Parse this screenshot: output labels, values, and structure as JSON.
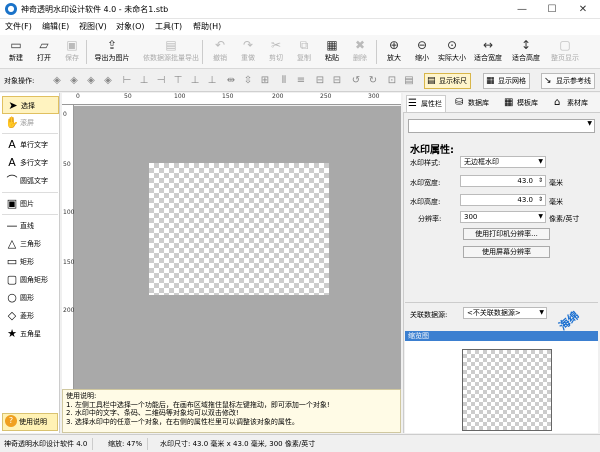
{
  "window": {
    "title": "神奇透明水印设计软件 4.0 - 未命名1.stb",
    "app_icon": "logo-icon",
    "controls": {
      "minimize": "—",
      "maximize": "☐",
      "close": "✕"
    }
  },
  "menu": [
    "文件(F)",
    "编辑(E)",
    "视图(V)",
    "对象(O)",
    "工具(T)",
    "帮助(H)"
  ],
  "toolbar": [
    {
      "label": "新建",
      "icon": "new-icon",
      "glyph": "▭",
      "enabled": true
    },
    {
      "label": "打开",
      "icon": "open-icon",
      "glyph": "▱",
      "enabled": true
    },
    {
      "label": "保存",
      "icon": "save-icon",
      "glyph": "▣",
      "enabled": false
    },
    {
      "label": "导出为图片",
      "icon": "export-image-icon",
      "glyph": "⇪",
      "enabled": true
    },
    {
      "label": "依数据源批量导出",
      "icon": "batch-export-icon",
      "glyph": "▤",
      "enabled": false
    },
    {
      "label": "撤销",
      "icon": "undo-icon",
      "glyph": "↶",
      "enabled": false
    },
    {
      "label": "重做",
      "icon": "redo-icon",
      "glyph": "↷",
      "enabled": false
    },
    {
      "label": "剪切",
      "icon": "cut-icon",
      "glyph": "✂",
      "enabled": false
    },
    {
      "label": "复制",
      "icon": "copy-icon",
      "glyph": "⧉",
      "enabled": false
    },
    {
      "label": "粘贴",
      "icon": "paste-icon",
      "glyph": "▦",
      "enabled": true
    },
    {
      "label": "删除",
      "icon": "delete-icon",
      "glyph": "✖",
      "enabled": false
    },
    {
      "label": "放大",
      "icon": "zoom-in-icon",
      "glyph": "⊕",
      "enabled": true
    },
    {
      "label": "缩小",
      "icon": "zoom-out-icon",
      "glyph": "⊖",
      "enabled": true
    },
    {
      "label": "实际大小",
      "icon": "actual-size-icon",
      "glyph": "⊙",
      "enabled": true
    },
    {
      "label": "适合宽度",
      "icon": "fit-width-icon",
      "glyph": "↔",
      "enabled": true
    },
    {
      "label": "适合高度",
      "icon": "fit-height-icon",
      "glyph": "↕",
      "enabled": true
    },
    {
      "label": "整页显示",
      "icon": "full-page-icon",
      "glyph": "▢",
      "enabled": false
    }
  ],
  "objbar": {
    "label": "对象操作:",
    "toggles": [
      {
        "label": "显示标尺",
        "icon": "ruler-icon",
        "glyph": "▤",
        "on": true
      },
      {
        "label": "显示网格",
        "icon": "grid-icon",
        "glyph": "▦",
        "on": false
      },
      {
        "label": "显示参考线",
        "icon": "guide-icon",
        "glyph": "↘",
        "on": false
      }
    ]
  },
  "tools": [
    {
      "label": "选择",
      "icon": "arrow-select-icon",
      "glyph": "➤",
      "active": true,
      "dim": false
    },
    {
      "label": "滚屏",
      "icon": "hand-scroll-icon",
      "glyph": "✋",
      "active": false,
      "dim": true
    },
    {
      "label": "单行文字",
      "icon": "single-line-text-icon",
      "glyph": "A",
      "active": false,
      "dim": false
    },
    {
      "label": "多行文字",
      "icon": "multi-line-text-icon",
      "glyph": "A",
      "active": false,
      "dim": false
    },
    {
      "label": "圆弧文字",
      "icon": "arc-text-icon",
      "glyph": "⌒",
      "active": false,
      "dim": false
    },
    {
      "label": "图片",
      "icon": "image-icon",
      "glyph": "▣",
      "active": false,
      "dim": false
    },
    {
      "label": "直线",
      "icon": "line-icon",
      "glyph": "—",
      "active": false,
      "dim": false
    },
    {
      "label": "三角形",
      "icon": "triangle-icon",
      "glyph": "△",
      "active": false,
      "dim": false
    },
    {
      "label": "矩形",
      "icon": "rectangle-icon",
      "glyph": "▭",
      "active": false,
      "dim": false
    },
    {
      "label": "圆角矩形",
      "icon": "rounded-rectangle-icon",
      "glyph": "▢",
      "active": false,
      "dim": false
    },
    {
      "label": "圆形",
      "icon": "circle-icon",
      "glyph": "○",
      "active": false,
      "dim": false
    },
    {
      "label": "菱形",
      "icon": "diamond-icon",
      "glyph": "◇",
      "active": false,
      "dim": false
    },
    {
      "label": "五角星",
      "icon": "star-icon",
      "glyph": "★",
      "active": false,
      "dim": false
    }
  ],
  "help_button": "使用说明",
  "ruler": {
    "top": [
      "0",
      "50",
      "100",
      "150",
      "200",
      "250",
      "300"
    ],
    "left": [
      "0",
      "50",
      "100",
      "150",
      "200"
    ]
  },
  "help_text": {
    "title": "使用说明:",
    "lines": [
      "1. 左侧工具栏中选择一个功能后，在画布区域拖住鼠标左键拖动，即可添加一个对象!",
      "2. 水印中的文字、条码、二维码等对象均可以双击修改!",
      "3. 选择水印中的任意一个对象，在右侧的属性栏里可以调整该对象的属性。"
    ]
  },
  "right_tabs": [
    {
      "label": "属性栏",
      "icon": "properties-icon",
      "glyph": "☰",
      "on": true
    },
    {
      "label": "数据库",
      "icon": "database-icon",
      "glyph": "⛁",
      "on": false
    },
    {
      "label": "模板库",
      "icon": "template-icon",
      "glyph": "▦",
      "on": false
    },
    {
      "label": "素材库",
      "icon": "material-icon",
      "glyph": "⌂",
      "on": false
    }
  ],
  "properties": {
    "title": "水印属性:",
    "style_label": "水印样式:",
    "style_value": "无边框水印",
    "width_label": "水印宽度:",
    "width_value": "43.0",
    "width_unit": "毫米",
    "height_label": "水印高度:",
    "height_value": "43.0",
    "height_unit": "毫米",
    "dpi_label": "分辨率:",
    "dpi_value": "300",
    "dpi_unit": "像素/英寸",
    "btn_printer": "使用打印机分辨率...",
    "btn_screen": "使用屏幕分辨率",
    "datasource_label": "关联数据源:",
    "datasource_value": "<不关联数据源>"
  },
  "preview_title": "缩览图",
  "status": {
    "app": "神奇透明水印设计软件 4.0",
    "zoom": "缩放: 47%",
    "size": "水印尺寸: 43.0 毫米 x 43.0 毫米, 300 像素/英寸"
  },
  "brand": {
    "text": "海绵软件",
    "color": "#1a6fd0"
  }
}
